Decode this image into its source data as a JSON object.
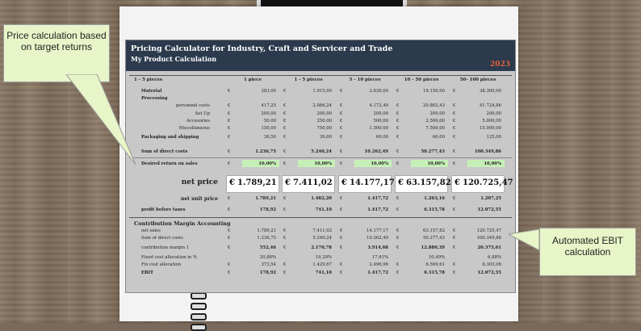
{
  "title": "Pricing Calculator for Industry, Craft and Servicer and Trade",
  "subtitle": "My Product Calculation",
  "year": "2023",
  "section_label": "1 - 5 pieces",
  "columns": [
    "1 piece",
    "1 - 5 pieces",
    "5 - 10 pieces",
    "10 - 50 pieces",
    "50- 100 pieces"
  ],
  "currency": "€",
  "rows": [
    {
      "label": "Material",
      "bold": true,
      "values": [
        "383,00",
        "1.915,00",
        "3.830,00",
        "19.150,00",
        "38.300,00"
      ]
    },
    {
      "label": "Processing",
      "bold": true,
      "values": [
        "",
        "",
        "",
        "",
        ""
      ]
    },
    {
      "label": "personnel costs",
      "values": [
        "417,25",
        "2.086,24",
        "4.172,49",
        "20.862,43",
        "41.724,86"
      ]
    },
    {
      "label": "Set Up",
      "values": [
        "200,00",
        "200,00",
        "200,00",
        "200,00",
        "200,00"
      ]
    },
    {
      "label": "Accesories",
      "values": [
        "50,00",
        "250,00",
        "500,00",
        "2.500,00",
        "5.000,00"
      ]
    },
    {
      "label": "Miscellaneous",
      "values": [
        "150,00",
        "750,00",
        "1.500,00",
        "7.500,00",
        "15.000,00"
      ]
    },
    {
      "label": "Packaging and shipping",
      "bold": true,
      "values": [
        "36,50",
        "39,00",
        "60,00",
        "60,00",
        "125,00"
      ]
    },
    {
      "label": "Sum of direct costs",
      "bold": true,
      "values": [
        "1.236,75",
        "5.240,24",
        "10.262,49",
        "50.277,43",
        "100.349,86"
      ]
    },
    {
      "label": "Desired return on sales",
      "bold": true,
      "values": [
        "10,00%",
        "10,00%",
        "10,00%",
        "10,00%",
        "10,00%"
      ]
    }
  ],
  "net_price": {
    "label": "net price",
    "values": [
      "1.789,21",
      "7.411,02",
      "14.177,17",
      "63.157,82",
      "120.725,47"
    ]
  },
  "net_unit_price": {
    "label": "net unit price",
    "values": [
      "1.789,21",
      "1.482,20",
      "1.417,72",
      "1.263,16",
      "1.207,25"
    ]
  },
  "profit": {
    "label": "profit before taxes",
    "values": [
      "178,92",
      "741,10",
      "1.417,72",
      "6.315,78",
      "12.072,55"
    ]
  },
  "cm_title": "Contribution Margin Accounting",
  "cm_rows": [
    {
      "label": "net sales",
      "values": [
        "1.789,21",
        "7.411,02",
        "14.177,17",
        "63.157,82",
        "120.725,47"
      ]
    },
    {
      "label": "Sum of direct costs",
      "values": [
        "1.236,75",
        "5.240,24",
        "10.262,49",
        "50.277,43",
        "100.349,86"
      ]
    },
    {
      "label": "contribution margin 1",
      "values": [
        "552,46",
        "2.170,78",
        "3.914,68",
        "12.880,39",
        "20.375,61"
      ]
    },
    {
      "label": "Fixed cost allocation in %",
      "values": [
        "20,88%",
        "19,29%",
        "17,61%",
        "10,40%",
        "6,88%"
      ]
    },
    {
      "label": "Fix cost allocation",
      "values": [
        "373,54",
        "1.429,67",
        "2.496,96",
        "6.569,61",
        "8.303,06"
      ]
    },
    {
      "label": "EBIT",
      "bold": true,
      "values": [
        "178,92",
        "741,10",
        "1.417,72",
        "6.315,78",
        "12.072,55"
      ]
    }
  ],
  "callout_left": "Price calculation based on target returns",
  "callout_right": "Automated EBIT calculation"
}
